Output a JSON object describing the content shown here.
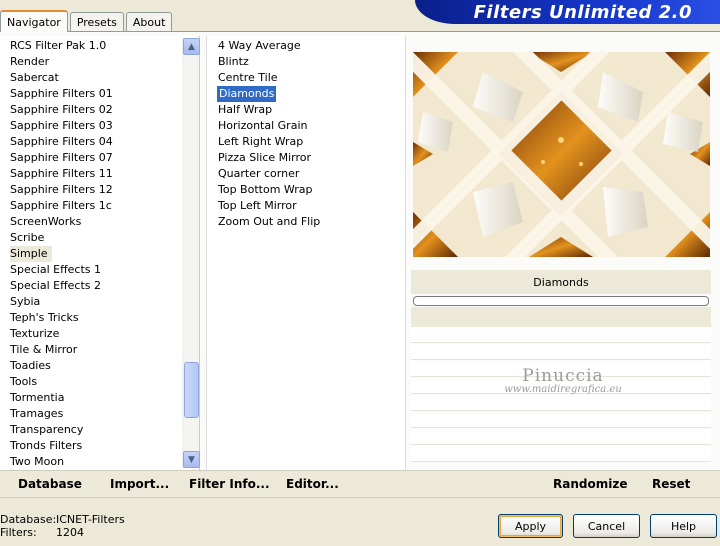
{
  "app_title": "Filters Unlimited 2.0",
  "tabs": [
    {
      "label": "Navigator",
      "active": true
    },
    {
      "label": "Presets",
      "active": false
    },
    {
      "label": "About",
      "active": false
    }
  ],
  "categories": [
    "RCS Filter Pak 1.0",
    "Render",
    "Sabercat",
    "Sapphire Filters 01",
    "Sapphire Filters 02",
    "Sapphire Filters 03",
    "Sapphire Filters 04",
    "Sapphire Filters 07",
    "Sapphire Filters 11",
    "Sapphire Filters 12",
    "Sapphire Filters 1c",
    "ScreenWorks",
    "Scribe",
    "Simple",
    "Special Effects 1",
    "Special Effects 2",
    "Sybia",
    "Teph's Tricks",
    "Texturize",
    "Tile & Mirror",
    "Toadies",
    "Tools",
    "Tormentia",
    "Tramages",
    "Transparency",
    "Tronds Filters",
    "Two Moon"
  ],
  "selected_category": "Simple",
  "filters": [
    "4 Way Average",
    "Blintz",
    "Centre Tile",
    "Diamonds",
    "Half Wrap",
    "Horizontal Grain",
    "Left Right Wrap",
    "Pizza Slice Mirror",
    "Quarter corner",
    "Top Bottom Wrap",
    "Top Left Mirror",
    "Zoom Out and Flip"
  ],
  "selected_filter": "Diamonds",
  "preview": {
    "filter_name": "Diamonds",
    "watermark_name": "Pinuccia",
    "watermark_url": "www.maidiregrafica.eu"
  },
  "toolbar": {
    "database": "Database",
    "import": "Import...",
    "filter_info": "Filter Info...",
    "editor": "Editor...",
    "randomize": "Randomize",
    "reset": "Reset"
  },
  "status": {
    "database_label": "Database:",
    "database_value": "ICNET-Filters",
    "filters_label": "Filters:",
    "filters_value": "1204"
  },
  "buttons": {
    "apply": "Apply",
    "cancel": "Cancel",
    "help": "Help"
  },
  "colors": {
    "selection": "#316ac5",
    "title_banner": "#1536c9",
    "tab_highlight": "#e68b2c"
  }
}
